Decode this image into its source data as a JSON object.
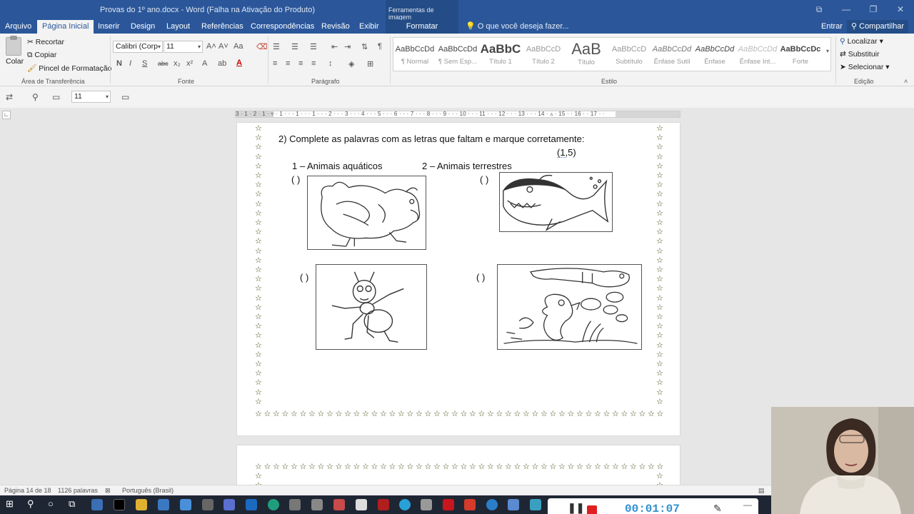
{
  "window": {
    "title": "Provas do 1º ano.docx - Word (Falha na Ativação do Produto)",
    "contextual_tools": "Ferramentas de imagem",
    "controls": [
      "⧉",
      "—",
      "❐",
      "✕"
    ]
  },
  "tabs": [
    "Arquivo",
    "Página Inicial",
    "Inserir",
    "Design",
    "Layout",
    "Referências",
    "Correspondências",
    "Revisão",
    "Exibir",
    "Formatar"
  ],
  "tell_me": "O que você deseja fazer...",
  "enter": "Entrar",
  "share": "Compartilhar",
  "clipboard": {
    "paste": "Colar",
    "cut": "Recortar",
    "copy": "Copiar",
    "format_painter": "Pincel de Formatação",
    "label": "Área de Transferência"
  },
  "font": {
    "family": "Calibri (Corp",
    "size": "11",
    "label": "Fonte",
    "bold": "N",
    "italic": "I",
    "underline": "S",
    "strike": "abc",
    "sub": "x₂",
    "sup": "x²"
  },
  "paragraph": {
    "label": "Parágrafo"
  },
  "styles": {
    "label": "Estilo",
    "items": [
      {
        "sample": "AaBbCcDd",
        "name": "¶ Normal"
      },
      {
        "sample": "AaBbCcDd",
        "name": "¶ Sem Esp..."
      },
      {
        "sample": "AaBbC",
        "name": "Título 1"
      },
      {
        "sample": "AaBbCcD",
        "name": "Título 2"
      },
      {
        "sample": "AaB",
        "name": "Título"
      },
      {
        "sample": "AaBbCcD",
        "name": "Subtítulo"
      },
      {
        "sample": "AaBbCcDd",
        "name": "Ênfase Sutil"
      },
      {
        "sample": "AaBbCcDd",
        "name": "Ênfase"
      },
      {
        "sample": "AaBbCcDd",
        "name": "Ênfase Int..."
      },
      {
        "sample": "AaBbCcDc",
        "name": "Forte"
      }
    ]
  },
  "editing": {
    "find": "Localizar",
    "replace": "Substituir",
    "select": "Selecionar",
    "label": "Edição"
  },
  "navbar": {
    "zoom_value": "11"
  },
  "ruler": {
    "ticks": "3 · 1 · 2 · 1 · ▿ · 1 · · · 1 · · · 1 · · · 2 · · · 3 · · · 4 · · · 5 · · · 6 · · · 7 · · · 8 · · · 9 · · · 10 · · · 11 · · · 12 · · · 13 · · · 14 · ▵ · 15 · · 16 · · 17 · ·"
  },
  "document": {
    "question": "2)  Complete as palavras com as letras que faltam e marque corretamente:",
    "points": "(1,5)",
    "category1": "1 – Animais aquáticos",
    "category2": "2 – Animais terrestres",
    "checkbox": "(   )",
    "star": "☆",
    "animals": [
      "galinha",
      "tubarão",
      "formiga",
      "cavalo-marinho e peixe"
    ]
  },
  "status": {
    "page": "Página 14 de 18",
    "words": "1126 palavras",
    "language": "Português (Brasil)"
  },
  "recorder": {
    "time": "00:01:07"
  },
  "colors": {
    "word_blue": "#2b579a",
    "recorder_time": "#2f8fd0",
    "stop": "#e02020"
  }
}
